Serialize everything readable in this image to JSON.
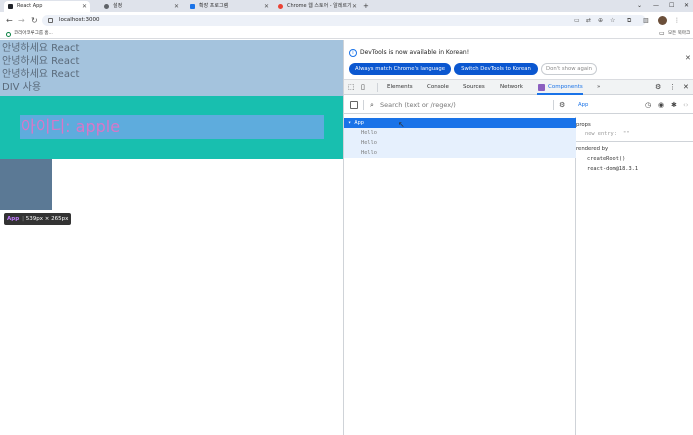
{
  "browser": {
    "tabs": [
      {
        "title": "React App",
        "active": true
      },
      {
        "title": "설정",
        "active": false
      },
      {
        "title": "확장 프로그램",
        "active": false
      },
      {
        "title": "Chrome 웹 스토어 - 알레르기",
        "active": false
      }
    ],
    "new_tab_symbol": "+",
    "window_controls": [
      "⌄",
      "—",
      "☐",
      "✕"
    ],
    "nav": {
      "back": "←",
      "forward": "→",
      "reload": "↻"
    },
    "url": "localhost:3000",
    "bookmark": "코리아코루그룹 홈...",
    "all_bookmarks": "모든 북마크"
  },
  "page": {
    "hello_lines": [
      "안녕하세요 React",
      "안녕하세요 React",
      "안녕하세요 React",
      "DIV 사용"
    ],
    "id_text": "아이디: apple",
    "tooltip": {
      "name": "App",
      "dims": "539px × 265px"
    },
    "colors": {
      "block_top": "#a4c3dd",
      "block_teal": "#18bfaf",
      "id_box": "#5eacdd",
      "id_text": "#d877c8",
      "dark_block": "#5b7995"
    }
  },
  "devtools": {
    "info_message": "DevTools is now available in Korean!",
    "buttons": {
      "match_language": "Always match Chrome's language",
      "switch_korean": "Switch DevTools to Korean",
      "dont_show": "Don't show again"
    },
    "tabs": [
      "Elements",
      "Console",
      "Sources",
      "Network",
      "Components"
    ],
    "active_tab": "Components",
    "more_tabs": "»",
    "search_placeholder": "Search (text or /regex/)",
    "tree": [
      {
        "label": "▾ App",
        "selected": true
      },
      {
        "label": "Hello",
        "selected": false
      },
      {
        "label": "Hello",
        "selected": false
      },
      {
        "label": "Hello",
        "selected": false
      }
    ],
    "selected_component": "App",
    "props_heading": "props",
    "prop_key": "new entry:",
    "prop_value": "\"\"",
    "rendered_by_heading": "rendered by",
    "rendered_by": [
      "createRoot()",
      "react-dom@18.3.1"
    ]
  }
}
